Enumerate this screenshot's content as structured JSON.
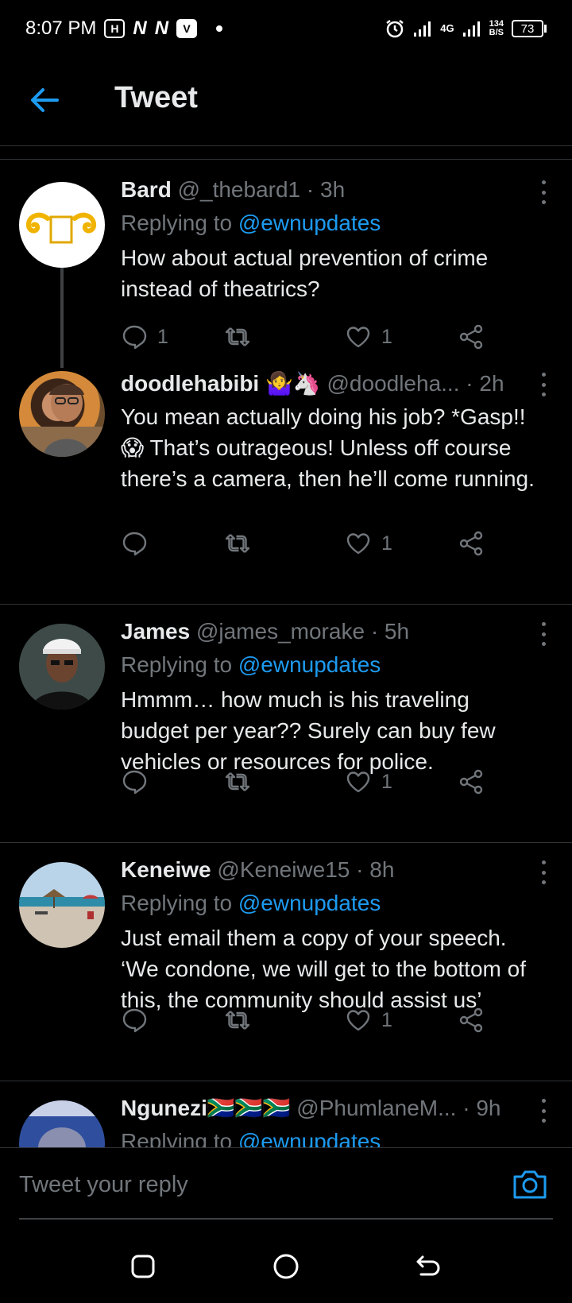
{
  "status_bar": {
    "time": "8:07 PM",
    "icons": [
      "hd-icon",
      "n-icon",
      "n-icon",
      "v-icon"
    ],
    "network": "4G",
    "speed_value": "134",
    "speed_unit": "B/S",
    "battery": "73"
  },
  "header": {
    "title": "Tweet"
  },
  "tweets": [
    {
      "name": "Bard",
      "handle": "@_thebard1",
      "time": "· 3h",
      "replying_prefix": "Replying to ",
      "replying_to": "@ewnupdates",
      "text": "How about actual prevention of crime instead of theatrics?",
      "replies": "1",
      "retweets": "",
      "likes": "1",
      "avatar": "bard-avatar"
    },
    {
      "name": "doodlehabibi 🤷‍♀️🦄",
      "handle": "@doodleha...",
      "time": "· 2h",
      "text": "You mean actually doing his job? *Gasp!! 😱 That’s outrageous! Unless off course there’s a camera, then he’ll come running.",
      "replies": "",
      "retweets": "",
      "likes": "1",
      "avatar": "doodlehabibi-avatar"
    },
    {
      "name": "James",
      "handle": "@james_morake",
      "time": "· 5h",
      "replying_prefix": "Replying to ",
      "replying_to": "@ewnupdates",
      "text": "Hmmm… how much is his traveling budget per year?? Surely can buy few vehicles or resources for police.",
      "replies": "",
      "retweets": "",
      "likes": "1",
      "avatar": "james-avatar"
    },
    {
      "name": "Keneiwe",
      "handle": "@Keneiwe15",
      "time": "· 8h",
      "replying_prefix": "Replying to ",
      "replying_to": "@ewnupdates",
      "text": "Just email them a copy of your speech. ‘We condone, we will get to the bottom of this, the community should assist us’",
      "replies": "",
      "retweets": "",
      "likes": "1",
      "avatar": "keneiwe-avatar"
    },
    {
      "name": "Ngunezi🇿🇦🇿🇦🇿🇦",
      "handle": "@PhumlaneM...",
      "time": "· 9h",
      "replying_prefix": "Replying to ",
      "replying_to": "@ewnupdates",
      "avatar": "ngunezi-avatar"
    }
  ],
  "composer": {
    "placeholder": "Tweet your reply"
  },
  "colors": {
    "background": "#000000",
    "accent": "#1d9bf0",
    "muted": "#71767b",
    "text": "#e7e9ea"
  }
}
